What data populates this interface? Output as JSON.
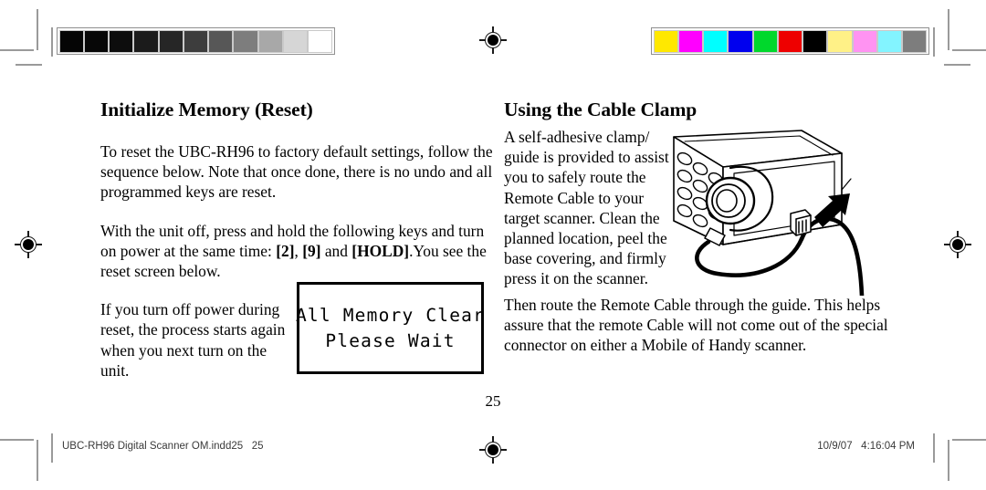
{
  "page": {
    "number": "25"
  },
  "left_column": {
    "heading": "Initialize Memory (Reset)",
    "paragraph_1": "To reset the UBC-RH96 to factory default settings, follow the sequence below. Note that once done, there is no undo and all programmed keys are reset.",
    "paragraph_2_part_1": "With the unit off, press and hold the following keys and turn on power at the same time: ",
    "key_2": "[2]",
    "paragraph_2_sep": ", ",
    "key_9": "[9]",
    "paragraph_2_part_2": " and ",
    "key_hold": "[HOLD]",
    "paragraph_2_part_3": ".You see the reset screen below.",
    "paragraph_3": "If you turn off power during reset, the process starts again when you next turn on the unit."
  },
  "lcd_display": {
    "line_1": "All Memory Clear",
    "line_2": "Please Wait"
  },
  "right_column": {
    "heading": "Using the Cable Clamp",
    "paragraph_1": "A self-adhesive clamp/ guide is provided to assist you to safely route the Remote Cable to your target scanner. Clean the planned location, peel the base covering, and firmly press it on the scanner.",
    "paragraph_2": "Then route the Remote Cable through the guide. This helps assure that the remote Cable will not come out of the special connector on either a Mobile of Handy scanner."
  },
  "footer": {
    "left": "UBC-RH96 Digital Scanner OM.indd25   25",
    "right": "10/9/07   4:16:04 PM"
  },
  "calibration": {
    "grayscale_patches": [
      "#050505",
      "#070707",
      "#0d0d0d",
      "#1b1b1b",
      "#262626",
      "#3d3d3d",
      "#575757",
      "#7d7d7d",
      "#a8a8a8",
      "#d6d6d6",
      "#ffffff"
    ],
    "color_patches": [
      "#ffe800",
      "#ff00ff",
      "#00ffff",
      "#0000ee",
      "#00d82c",
      "#ee0000",
      "#000000",
      "#fff187",
      "#ff93f2",
      "#83f4ff",
      "#7d7d7d"
    ]
  }
}
